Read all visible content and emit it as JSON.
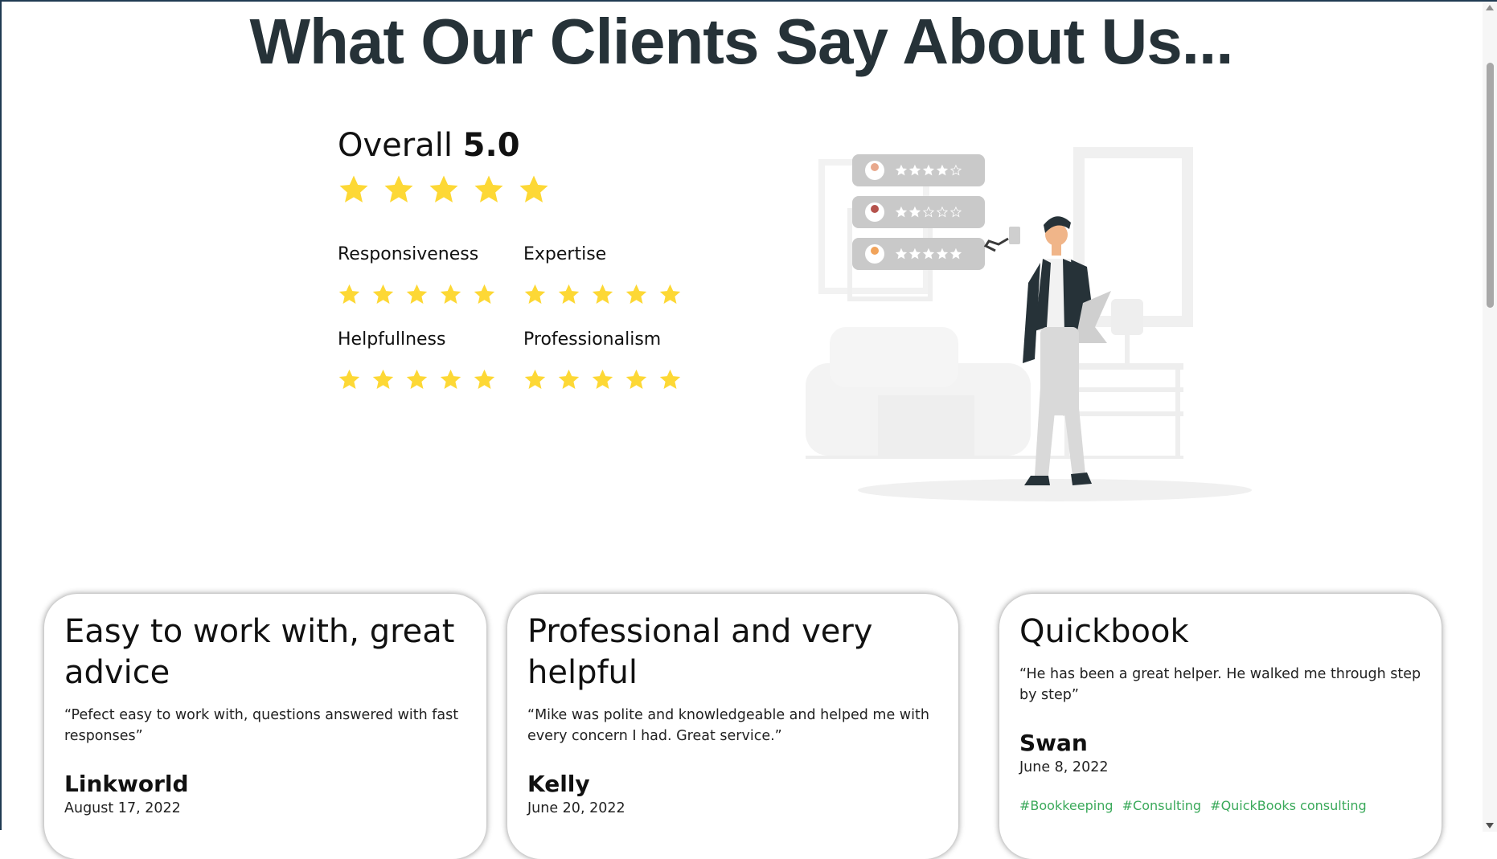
{
  "header": {
    "title": "What Our Clients Say About Us..."
  },
  "overall": {
    "label": "Overall",
    "score": "5.0",
    "stars": 5
  },
  "categories": [
    {
      "label": "Responsiveness",
      "stars": 5
    },
    {
      "label": "Expertise",
      "stars": 5
    },
    {
      "label": "Helpfullness",
      "stars": 5
    },
    {
      "label": "Professionalism",
      "stars": 5
    }
  ],
  "illustration": {
    "icon": "customer-review-illustration",
    "review_ratings": [
      4,
      2,
      5
    ]
  },
  "reviews": [
    {
      "title": "Easy to work with, great advice",
      "quote": "“Pefect easy to work with, questions answered with fast responses”",
      "name": "Linkworld",
      "date": "August 17, 2022"
    },
    {
      "title": "Professional and very helpful",
      "quote": "“Mike was polite and knowledgeable and helped me with every concern I had. Great service.”",
      "name": "Kelly",
      "date": "June 20, 2022"
    },
    {
      "title": "Quickbook",
      "quote": "“He has been a great helper. He walked me through step by step”",
      "name": "Swan",
      "date": "June 8, 2022",
      "tags": [
        "#Bookkeeping",
        "#Consulting",
        "#QuickBooks consulting"
      ]
    }
  ],
  "colors": {
    "star": "#FDD835",
    "title": "#263238",
    "tag": "#3aa95a"
  }
}
